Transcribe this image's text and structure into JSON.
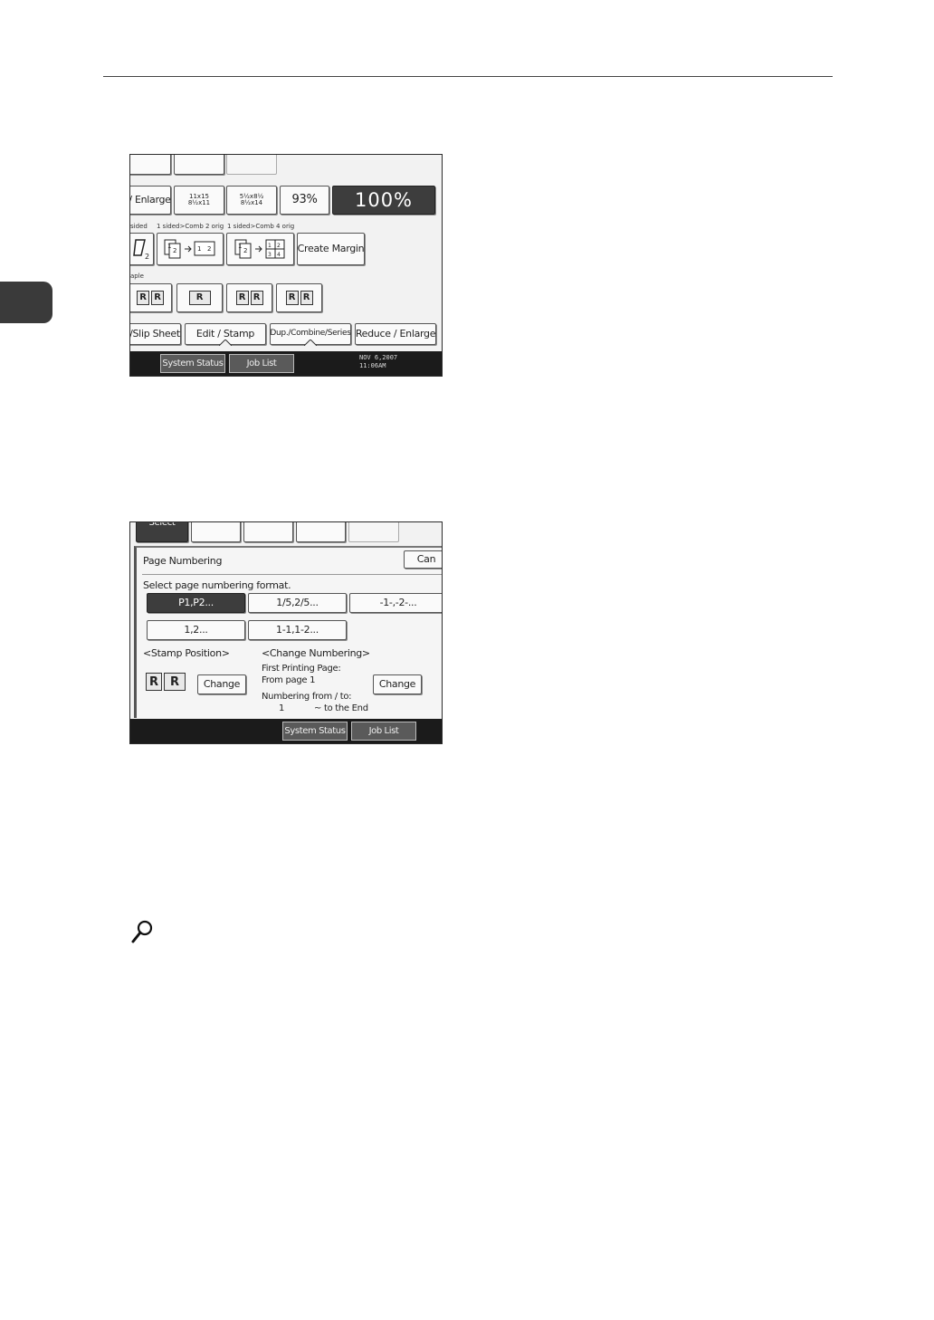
{
  "screen1": {
    "reduce_enlarge_label": "/ Enlarge",
    "preset1_top": "11x15",
    "preset1_bottom": "8½x11",
    "preset2_top": "5½x8½",
    "preset2_bottom": "8½x14",
    "ratio_93": "93%",
    "ratio_100": "100%",
    "section_labels": {
      "duplex": "sided",
      "comb2": "1 sided>Comb 2 orig",
      "comb4": "1 sided>Comb 4 orig",
      "staple": "aple"
    },
    "create_margin": "Create Margin",
    "tabs": [
      "/Slip Sheet",
      "Edit / Stamp",
      "Dup./Combine/Series",
      "Reduce / Enlarge"
    ],
    "status": {
      "system_status": "System Status",
      "job_list": "Job List",
      "date": "NOV   6,2007",
      "time": "11:06AM"
    }
  },
  "screen2": {
    "top_tab": "Select",
    "title": "Page Numbering",
    "cancel": "Can",
    "instruction": "Select page numbering format.",
    "formats": [
      "P1,P2...",
      "1/5,2/5...",
      "-1-,-2-...",
      "1,2...",
      "1-1,1-2..."
    ],
    "stamp_position": "<Stamp Position>",
    "change_numbering": "<Change Numbering>",
    "change": "Change",
    "first_printing_page": "First Printing Page:",
    "from_page": "From page 1",
    "numbering_from_to": "Numbering from / to:",
    "numbering_start": "1",
    "to_the_end": "~ to the End",
    "status": {
      "system_status": "System Status",
      "job_list": "Job List"
    }
  }
}
